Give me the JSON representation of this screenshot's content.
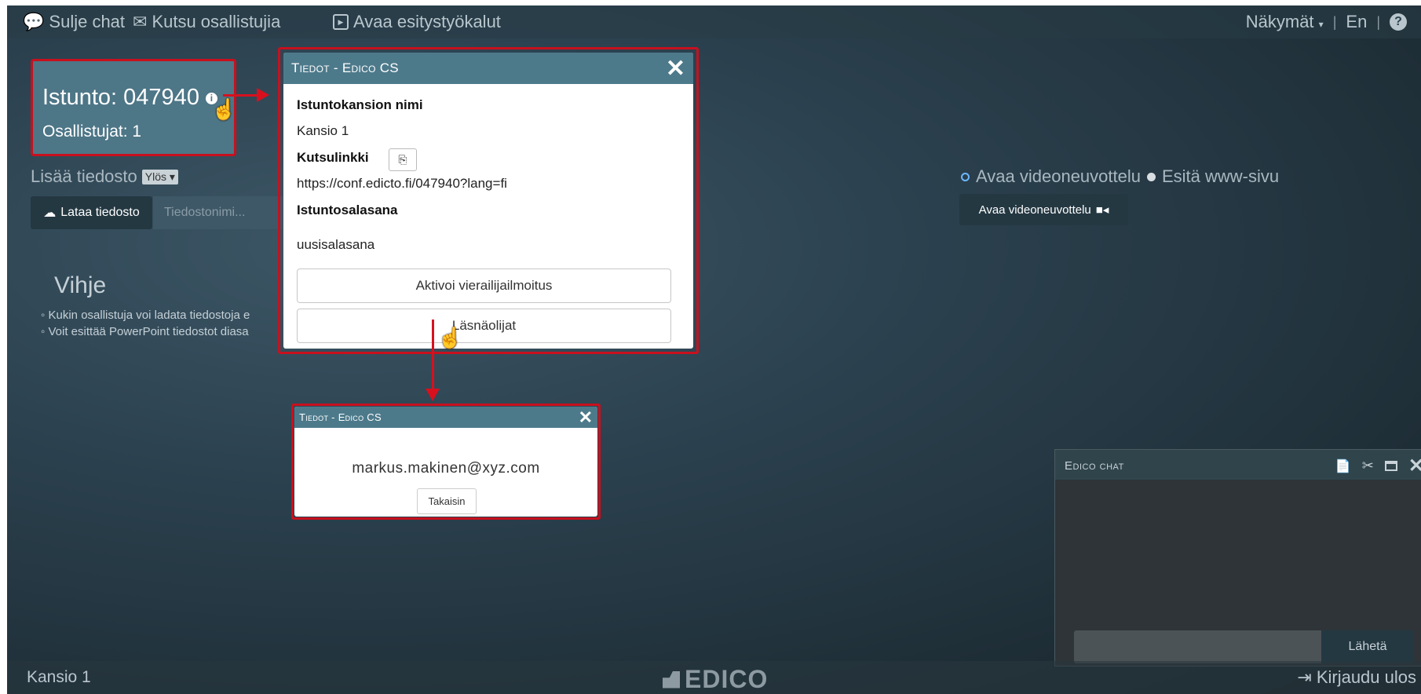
{
  "topbar": {
    "close_chat": "Sulje chat",
    "invite": "Kutsu osallistujia",
    "open_tools": "Avaa esitystyökalut",
    "views": "Näkymät",
    "language": "En"
  },
  "session": {
    "title": "Istunto: 047940",
    "participants": "Osallistujat: 1"
  },
  "files": {
    "add_file_label": "Lisää tiedosto",
    "direction_select": "Ylös",
    "upload_button": "Lataa tiedosto",
    "filename_placeholder": "Tiedostonimi..."
  },
  "hint": {
    "title": "Vihje",
    "items": [
      "Kukin osallistuja voi ladata tiedostoja e",
      "Voit esittää PowerPoint tiedostot diasa"
    ]
  },
  "conference": {
    "option_video": "Avaa videoneuvottelu",
    "option_web": "Esitä www-sivu",
    "video_button": "Avaa videoneuvottelu"
  },
  "info_dialog": {
    "title": "Tiedot - Edico CS",
    "folder_label": "Istuntokansion nimi",
    "folder_value": "Kansio 1",
    "invite_label": "Kutsulinkki",
    "invite_value": "https://conf.edicto.fi/047940?lang=fi",
    "password_label": "Istuntosalasana",
    "password_value": "uusisalasana",
    "guest_button": "Aktivoi vierailijailmoitus",
    "attendees_button": "Läsnäolijat"
  },
  "attendee_dialog": {
    "title": "Tiedot - Edico CS",
    "email": "markus.makinen@xyz.com",
    "back_button": "Takaisin"
  },
  "chat": {
    "title": "Edico chat",
    "send_button": "Lähetä"
  },
  "footer": {
    "folder": "Kansio 1",
    "logo": "EDICO",
    "logout": "Kirjaudu ulos"
  },
  "colors": {
    "accent_red": "#c8101e",
    "dialog_header": "#4d7a8b",
    "dark_button": "#243842"
  },
  "icons": [
    "chat-icon",
    "envelope-icon",
    "present-icon",
    "info-icon",
    "hand-cursor-icon",
    "upload-icon",
    "video-camera-icon",
    "copy-icon",
    "close-icon",
    "export-icon",
    "cut-icon",
    "maximize-icon",
    "logout-icon",
    "help-icon",
    "caret-down-icon"
  ]
}
